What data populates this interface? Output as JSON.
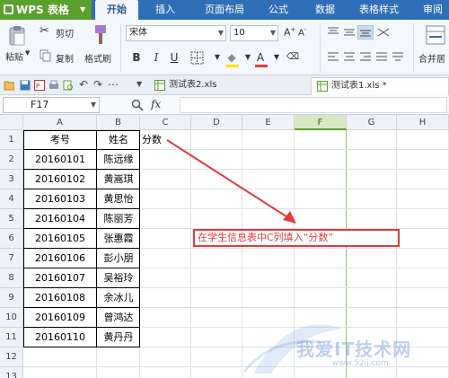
{
  "app": {
    "title": "WPS 表格"
  },
  "menu": {
    "tabs": [
      "开始",
      "插入",
      "页面布局",
      "公式",
      "数据",
      "表格样式",
      "审阅"
    ]
  },
  "ribbon": {
    "paste": "粘贴",
    "cut": "剪切",
    "copy": "复制",
    "format_painter": "格式刷",
    "font_name": "宋体",
    "font_size": "10",
    "merge_center": "合并居"
  },
  "doc_tabs": [
    "测试表2.xls",
    "测试表1.xls *"
  ],
  "formula_bar": {
    "cell_ref": "F17",
    "fx": "fx",
    "value": ""
  },
  "sheet": {
    "columns": [
      "A",
      "B",
      "C",
      "D",
      "E",
      "F",
      "G",
      "H"
    ],
    "selected_column": "F",
    "rows": [
      {
        "num": "1",
        "a": "考号",
        "b": "姓名",
        "c": "分数"
      },
      {
        "num": "2",
        "a": "20160101",
        "b": "陈远缘",
        "c": ""
      },
      {
        "num": "3",
        "a": "20160102",
        "b": "黄嵩琪",
        "c": ""
      },
      {
        "num": "4",
        "a": "20160103",
        "b": "黄思怡",
        "c": ""
      },
      {
        "num": "5",
        "a": "20160104",
        "b": "陈丽芳",
        "c": ""
      },
      {
        "num": "6",
        "a": "20160105",
        "b": "张惠霞",
        "c": ""
      },
      {
        "num": "7",
        "a": "20160106",
        "b": "彭小朋",
        "c": ""
      },
      {
        "num": "8",
        "a": "20160107",
        "b": "吴裕玲",
        "c": ""
      },
      {
        "num": "9",
        "a": "20160108",
        "b": "余冰儿",
        "c": ""
      },
      {
        "num": "10",
        "a": "20160109",
        "b": "曾鸿达",
        "c": ""
      },
      {
        "num": "11",
        "a": "20160110",
        "b": "黄丹丹",
        "c": ""
      },
      {
        "num": "12",
        "a": "",
        "b": "",
        "c": ""
      },
      {
        "num": "13",
        "a": "",
        "b": "",
        "c": ""
      }
    ]
  },
  "annotation": {
    "text": "在学生信息表中C列填入“分数”",
    "color": "#e23b3b"
  },
  "watermark": {
    "text": "我爱IT技术网",
    "url": "www.52ij.com"
  },
  "colors": {
    "menu_bg": "#2f6fb7",
    "app_btn": "#5aa02c",
    "accent_red": "#e23b3b"
  }
}
